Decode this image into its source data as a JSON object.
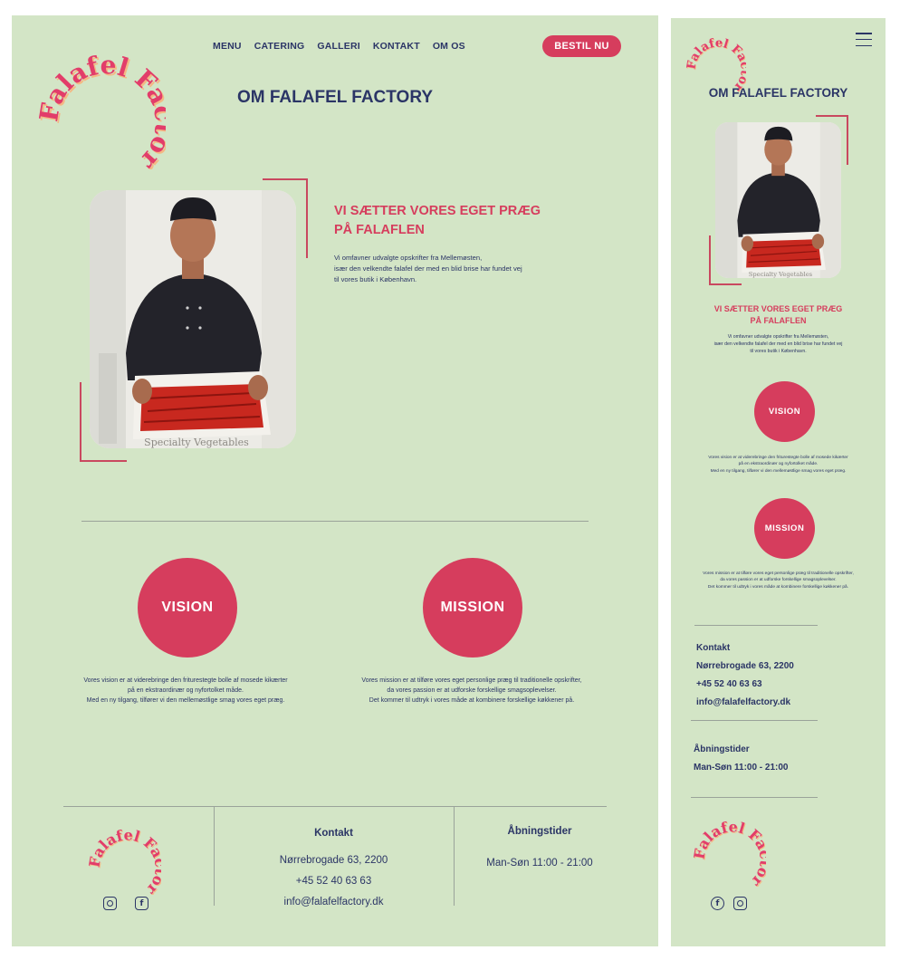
{
  "brand": {
    "logo_word1": "Falafel",
    "logo_word2": "Factory"
  },
  "nav": {
    "items": [
      "MENU",
      "CATERING",
      "GALLERI",
      "KONTAKT",
      "OM OS"
    ],
    "cta": "BESTIL NU"
  },
  "page_title": "OM FALAFEL FACTORY",
  "intro": {
    "heading_line1": "VI SÆTTER VORES EGET PRÆG",
    "heading_line2": "PÅ FALAFLEN",
    "body_lines": [
      "Vi omfavner udvalgte opskrifter fra Mellemøsten,",
      "især den velkendte falafel der med en blid brise har fundet vej",
      "til vores butik i København."
    ]
  },
  "photo": {
    "box_text": "Specialty Vegetables"
  },
  "vision": {
    "label": "VISION",
    "lines": [
      "Vores vision er at viderebringe den friturestegte bolle af mosede kikærter",
      "på en ekstraordinær og nyfortolket måde.",
      "Med en ny tilgang, tilfører vi den mellemøstlige smag vores eget præg."
    ]
  },
  "mission": {
    "label": "MISSION",
    "lines": [
      "Vores mission er at tilføre vores eget personlige præg til traditionelle opskrifter,",
      "da vores passion er at udforske forskellige smagsoplevelser.",
      "Det kommer til udtryk i vores måde at kombinere forskellige køkkener på."
    ]
  },
  "footer": {
    "contact_title": "Kontakt",
    "address": "Nørrebrogade 63, 2200",
    "phone": "+45 52 40 63 63",
    "email": "info@falafelfactory.dk",
    "hours_title": "Åbningstider",
    "hours": "Man-Søn 11:00 - 21:00"
  },
  "mobile": {
    "vision_lines": [
      "Vores vision er at viderebringe den friturestegte bolle af mosede kikærter",
      "på en ekstraordinær og nyfortolket måde.",
      "Med en ny tilgang, tilfører vi den mellemøstlige smag vores eget præg."
    ],
    "mission_lines": [
      "Vores mission er at tilføre vores eget personlige præg til traditionelle opskrifter,",
      "da vores passion er at udforske forskellige smagsoplevelser.",
      "Det kommer til udtryk i vores måde at kombinere forskellige køkkener på."
    ]
  },
  "colors": {
    "background": "#d3e5c6",
    "accent": "#d63d5d",
    "navy": "#2b3566",
    "logo_fill": "#e23d6a",
    "logo_shadow": "#f4b884"
  },
  "icons": [
    "hamburger-menu-icon",
    "instagram-icon",
    "facebook-icon"
  ]
}
